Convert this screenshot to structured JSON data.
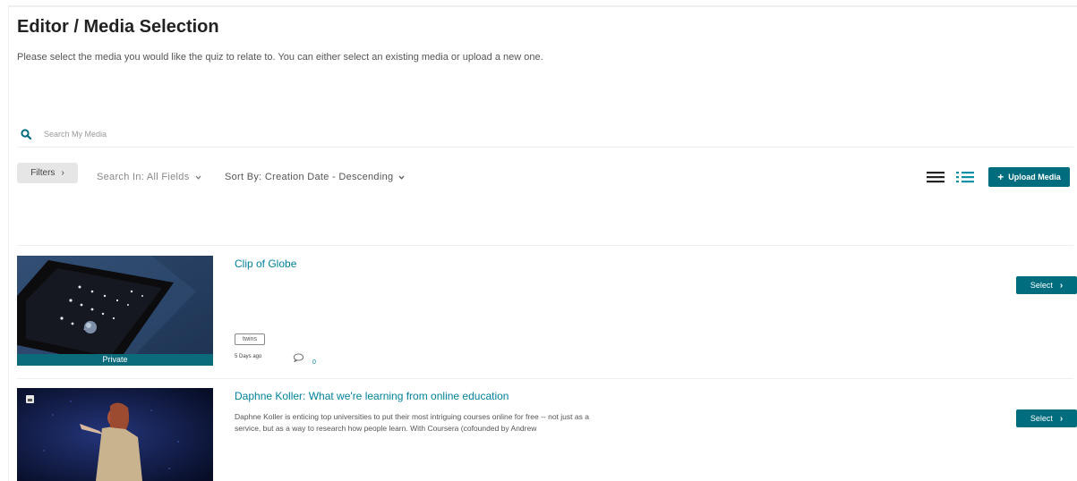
{
  "page": {
    "title": "Editor / Media Selection",
    "subtitle": "Please select the media you would like the quiz to relate to. You can either select an existing media or upload a new one."
  },
  "search": {
    "placeholder": "Search My Media"
  },
  "toolbar": {
    "filters_label": "Filters",
    "search_in_label": "Search In: All Fields",
    "sort_by_label": "Sort By: Creation Date - Descending",
    "upload_label": "Upload Media",
    "view_icons": [
      "list-view-icon",
      "detailed-list-view-icon"
    ]
  },
  "media": [
    {
      "title": "Clip of Globe",
      "privacy": "Private",
      "tags": [
        "twins"
      ],
      "date": "5 Days ago",
      "comments": "0",
      "select_label": "Select"
    },
    {
      "title": "Daphne Koller: What we're learning from online education",
      "description": "Daphne Koller is enticing top universities to put their most intriguing courses online for free -- not just as a service, but as a way to research how people learn. With Coursera (cofounded by Andrew",
      "select_label": "Select"
    }
  ],
  "colors": {
    "accent": "#006d7e",
    "link": "#00829b",
    "private_bar": "#0b6b7b"
  }
}
